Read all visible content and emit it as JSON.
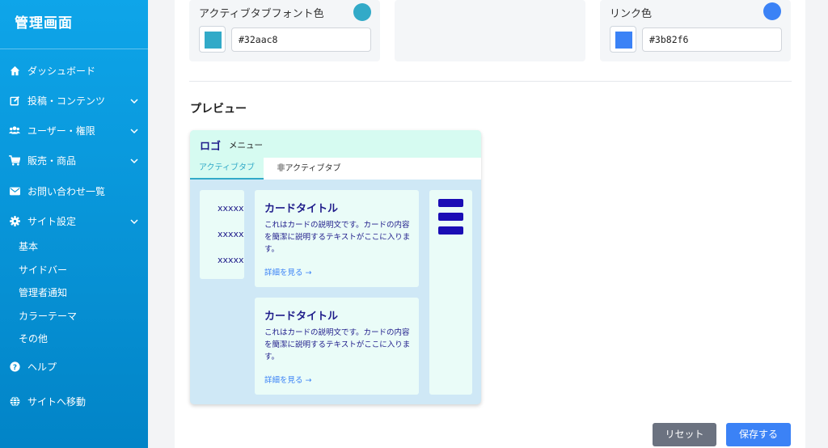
{
  "sidebar": {
    "title": "管理画面",
    "items": [
      {
        "label": "ダッシュボード",
        "icon": "home-icon"
      },
      {
        "label": "投稿・コンテンツ",
        "icon": "edit-icon"
      },
      {
        "label": "ユーザー・権限",
        "icon": "users-icon"
      },
      {
        "label": "販売・商品",
        "icon": "cart-icon"
      },
      {
        "label": "お問い合わせ一覧",
        "icon": "envelope-icon"
      },
      {
        "label": "サイト設定",
        "icon": "gear-icon"
      },
      {
        "label": "ヘルプ",
        "icon": "help-icon"
      },
      {
        "label": "サイトへ移動",
        "icon": "globe-icon"
      }
    ],
    "subitems": [
      "基本",
      "サイドバー",
      "管理者通知",
      "カラーテーマ",
      "その他"
    ]
  },
  "settings": {
    "active_tab_font": {
      "label": "アクティブタブフォント色",
      "value": "#32aac8",
      "color": "#32aac8"
    },
    "link_color": {
      "label": "リンク色",
      "value": "#3b82f6",
      "color": "#3b82f6"
    }
  },
  "preview": {
    "title": "プレビュー",
    "logo": "ロゴ",
    "menu": "メニュー",
    "tab_active": "アクティブタブ",
    "tab_inactive": "非アクティブタブ",
    "side_items": [
      "xxxxx",
      "xxxxx",
      "xxxxx"
    ],
    "cards": [
      {
        "title": "カードタイトル",
        "desc": "これはカードの説明文です。カードの内容を簡潔に説明するテキストがここに入ります。",
        "link": "詳細を見る →"
      },
      {
        "title": "カードタイトル",
        "desc": "これはカードの説明文です。カードの内容を簡潔に説明するテキストがここに入ります。",
        "link": "詳細を見る →"
      }
    ]
  },
  "buttons": {
    "reset": "リセット",
    "save": "保存する"
  }
}
